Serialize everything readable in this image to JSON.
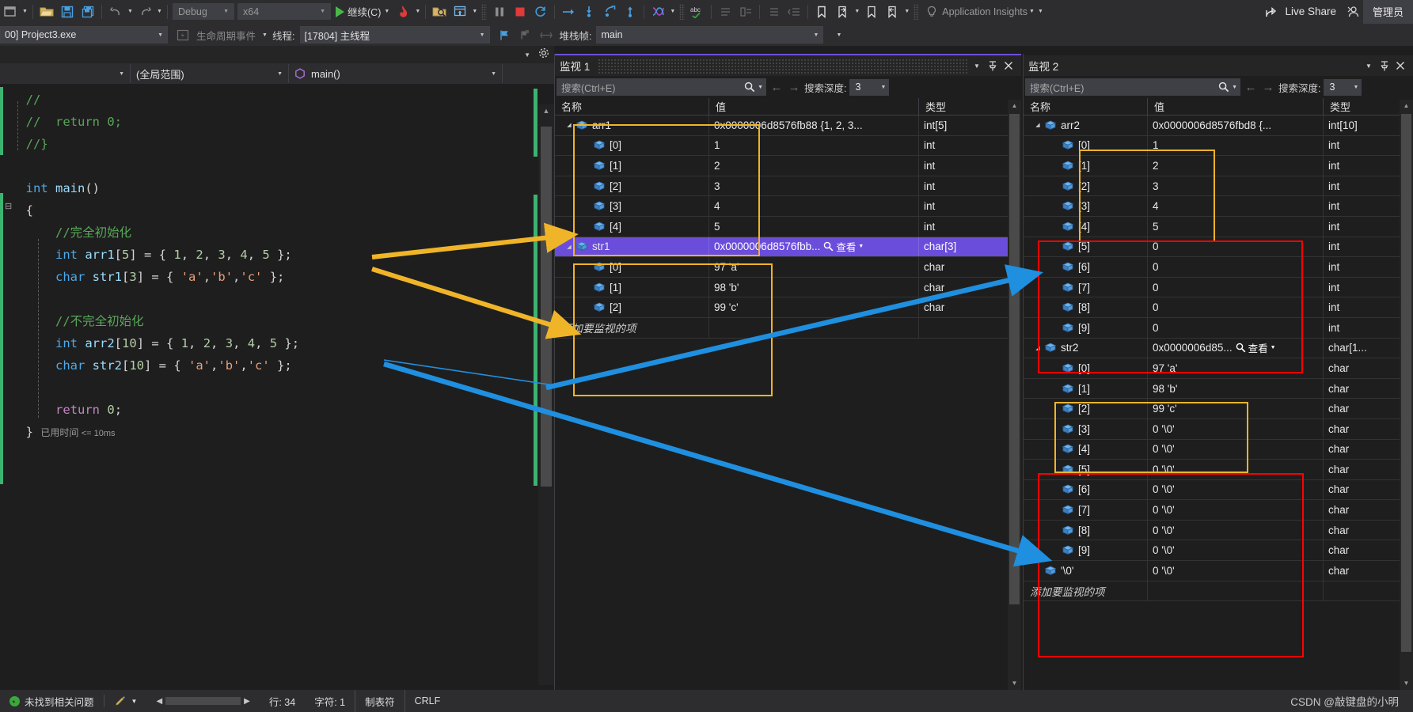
{
  "toolbar": {
    "config_combo": "Debug",
    "platform_combo": "x64",
    "continue_label": "继续(C)",
    "app_insights": "Application Insights",
    "live_share": "Live Share",
    "admin": "管理员",
    "icons": [
      "window-icon",
      "open-folder-icon",
      "save-icon",
      "save-all-icon",
      "undo-icon",
      "redo-icon",
      "play-icon",
      "hot-reload-icon",
      "attach-process-icon",
      "window-layout-icon",
      "pause-icon",
      "stop-icon",
      "restart-icon",
      "step-over-icon",
      "step-into-icon",
      "step-out-icon",
      "step-up-icon",
      "threads-icon",
      "spellcheck-icon",
      "indent-icon",
      "comment-icon",
      "uncomment-icon",
      "outdent-icon",
      "bookmark-icon",
      "bookmark-next-icon",
      "bookmark-prev-icon",
      "lightbulb-icon",
      "share-icon",
      "user-icon"
    ]
  },
  "debugbar": {
    "process_combo": "00] Project3.exe",
    "lifecycle_events": "生命周期事件",
    "thread_label": "线程:",
    "thread_value": "[17804] 主线程",
    "stackframe_label": "堆栈帧:",
    "stackframe_value": "main"
  },
  "editor": {
    "scope_combo": "(全局范围)",
    "member_combo": "main()",
    "empty_combo": "",
    "elapsed_note": "已用时间 <= 10ms",
    "lines": [
      {
        "indent": 0,
        "tokens": [
          {
            "t": "//",
            "c": "c-comment"
          }
        ]
      },
      {
        "indent": 0,
        "tokens": [
          {
            "t": "//  return 0;",
            "c": "c-comment"
          }
        ]
      },
      {
        "indent": 0,
        "tokens": [
          {
            "t": "//}",
            "c": "c-comment"
          }
        ]
      },
      {
        "indent": 0,
        "tokens": []
      },
      {
        "indent": 0,
        "tokens": [
          {
            "t": "int",
            "c": "c-type"
          },
          {
            "t": " ",
            "c": "c-plain"
          },
          {
            "t": "main",
            "c": "c-id"
          },
          {
            "t": "()",
            "c": "c-plain"
          }
        ]
      },
      {
        "indent": 0,
        "tokens": [
          {
            "t": "{",
            "c": "c-plain"
          }
        ]
      },
      {
        "indent": 1,
        "tokens": [
          {
            "t": "//完全初始化",
            "c": "c-comment"
          }
        ]
      },
      {
        "indent": 1,
        "tokens": [
          {
            "t": "int",
            "c": "c-type"
          },
          {
            "t": " ",
            "c": "c-plain"
          },
          {
            "t": "arr1",
            "c": "c-id"
          },
          {
            "t": "[",
            "c": "c-plain"
          },
          {
            "t": "5",
            "c": "c-num"
          },
          {
            "t": "] = { ",
            "c": "c-plain"
          },
          {
            "t": "1",
            "c": "c-num"
          },
          {
            "t": ", ",
            "c": "c-plain"
          },
          {
            "t": "2",
            "c": "c-num"
          },
          {
            "t": ", ",
            "c": "c-plain"
          },
          {
            "t": "3",
            "c": "c-num"
          },
          {
            "t": ", ",
            "c": "c-plain"
          },
          {
            "t": "4",
            "c": "c-num"
          },
          {
            "t": ", ",
            "c": "c-plain"
          },
          {
            "t": "5",
            "c": "c-num"
          },
          {
            "t": " };",
            "c": "c-plain"
          }
        ]
      },
      {
        "indent": 1,
        "tokens": [
          {
            "t": "char",
            "c": "c-type"
          },
          {
            "t": " ",
            "c": "c-plain"
          },
          {
            "t": "str1",
            "c": "c-id"
          },
          {
            "t": "[",
            "c": "c-plain"
          },
          {
            "t": "3",
            "c": "c-num"
          },
          {
            "t": "] = { ",
            "c": "c-plain"
          },
          {
            "t": "'a'",
            "c": "c-str"
          },
          {
            "t": ",",
            "c": "c-plain"
          },
          {
            "t": "'b'",
            "c": "c-str"
          },
          {
            "t": ",",
            "c": "c-plain"
          },
          {
            "t": "'c'",
            "c": "c-str"
          },
          {
            "t": " };",
            "c": "c-plain"
          }
        ]
      },
      {
        "indent": 1,
        "tokens": []
      },
      {
        "indent": 1,
        "tokens": [
          {
            "t": "//不完全初始化",
            "c": "c-comment"
          }
        ]
      },
      {
        "indent": 1,
        "tokens": [
          {
            "t": "int",
            "c": "c-type"
          },
          {
            "t": " ",
            "c": "c-plain"
          },
          {
            "t": "arr2",
            "c": "c-id"
          },
          {
            "t": "[",
            "c": "c-plain"
          },
          {
            "t": "10",
            "c": "c-num"
          },
          {
            "t": "] = { ",
            "c": "c-plain"
          },
          {
            "t": "1",
            "c": "c-num"
          },
          {
            "t": ", ",
            "c": "c-plain"
          },
          {
            "t": "2",
            "c": "c-num"
          },
          {
            "t": ", ",
            "c": "c-plain"
          },
          {
            "t": "3",
            "c": "c-num"
          },
          {
            "t": ", ",
            "c": "c-plain"
          },
          {
            "t": "4",
            "c": "c-num"
          },
          {
            "t": ", ",
            "c": "c-plain"
          },
          {
            "t": "5",
            "c": "c-num"
          },
          {
            "t": " };",
            "c": "c-plain"
          }
        ]
      },
      {
        "indent": 1,
        "tokens": [
          {
            "t": "char",
            "c": "c-type"
          },
          {
            "t": " ",
            "c": "c-plain"
          },
          {
            "t": "str2",
            "c": "c-id"
          },
          {
            "t": "[",
            "c": "c-plain"
          },
          {
            "t": "10",
            "c": "c-num"
          },
          {
            "t": "] = { ",
            "c": "c-plain"
          },
          {
            "t": "'a'",
            "c": "c-str"
          },
          {
            "t": ",",
            "c": "c-plain"
          },
          {
            "t": "'b'",
            "c": "c-str"
          },
          {
            "t": ",",
            "c": "c-plain"
          },
          {
            "t": "'c'",
            "c": "c-str"
          },
          {
            "t": " };",
            "c": "c-plain"
          }
        ]
      },
      {
        "indent": 1,
        "tokens": []
      },
      {
        "indent": 1,
        "tokens": [
          {
            "t": "return",
            "c": "c-ret"
          },
          {
            "t": " ",
            "c": "c-plain"
          },
          {
            "t": "0",
            "c": "c-num"
          },
          {
            "t": ";",
            "c": "c-plain"
          }
        ]
      },
      {
        "indent": 0,
        "tokens": [
          {
            "t": "}",
            "c": "c-plain"
          }
        ]
      }
    ]
  },
  "watch1": {
    "title": "监视 1",
    "search_placeholder": "搜索(Ctrl+E)",
    "depth_label": "搜索深度:",
    "depth_value": "3",
    "columns": [
      "名称",
      "值",
      "类型"
    ],
    "add_watch": "添加要监视的项",
    "view_label": "查看",
    "rows": [
      {
        "name": "arr1",
        "value": "0x0000006d8576fb88 {1, 2, 3...",
        "type": "int[5]",
        "depth": 0,
        "expander": "▾",
        "selected": false
      },
      {
        "name": "[0]",
        "value": "1",
        "type": "int",
        "depth": 1,
        "expander": "",
        "selected": false
      },
      {
        "name": "[1]",
        "value": "2",
        "type": "int",
        "depth": 1,
        "expander": "",
        "selected": false
      },
      {
        "name": "[2]",
        "value": "3",
        "type": "int",
        "depth": 1,
        "expander": "",
        "selected": false
      },
      {
        "name": "[3]",
        "value": "4",
        "type": "int",
        "depth": 1,
        "expander": "",
        "selected": false
      },
      {
        "name": "[4]",
        "value": "5",
        "type": "int",
        "depth": 1,
        "expander": "",
        "selected": false
      },
      {
        "name": "str1",
        "value": "0x0000006d8576fbb...",
        "type": "char[3]",
        "depth": 0,
        "expander": "▾",
        "selected": true,
        "magnifier": true
      },
      {
        "name": "[0]",
        "value": "97 'a'",
        "type": "char",
        "depth": 1,
        "expander": "",
        "selected": false
      },
      {
        "name": "[1]",
        "value": "98 'b'",
        "type": "char",
        "depth": 1,
        "expander": "",
        "selected": false
      },
      {
        "name": "[2]",
        "value": "99 'c'",
        "type": "char",
        "depth": 1,
        "expander": "",
        "selected": false
      }
    ]
  },
  "watch2": {
    "title": "监视 2",
    "search_placeholder": "搜索(Ctrl+E)",
    "depth_label": "搜索深度:",
    "depth_value": "3",
    "columns": [
      "名称",
      "值",
      "类型"
    ],
    "add_watch": "添加要监视的项",
    "view_label": "查看",
    "rows": [
      {
        "name": "arr2",
        "value": "0x0000006d8576fbd8 {...",
        "type": "int[10]",
        "depth": 0,
        "expander": "▾",
        "selected": false
      },
      {
        "name": "[0]",
        "value": "1",
        "type": "int",
        "depth": 1,
        "expander": "",
        "selected": false
      },
      {
        "name": "[1]",
        "value": "2",
        "type": "int",
        "depth": 1,
        "expander": "",
        "selected": false
      },
      {
        "name": "[2]",
        "value": "3",
        "type": "int",
        "depth": 1,
        "expander": "",
        "selected": false
      },
      {
        "name": "[3]",
        "value": "4",
        "type": "int",
        "depth": 1,
        "expander": "",
        "selected": false
      },
      {
        "name": "[4]",
        "value": "5",
        "type": "int",
        "depth": 1,
        "expander": "",
        "selected": false
      },
      {
        "name": "[5]",
        "value": "0",
        "type": "int",
        "depth": 1,
        "expander": "",
        "selected": false
      },
      {
        "name": "[6]",
        "value": "0",
        "type": "int",
        "depth": 1,
        "expander": "",
        "selected": false
      },
      {
        "name": "[7]",
        "value": "0",
        "type": "int",
        "depth": 1,
        "expander": "",
        "selected": false
      },
      {
        "name": "[8]",
        "value": "0",
        "type": "int",
        "depth": 1,
        "expander": "",
        "selected": false
      },
      {
        "name": "[9]",
        "value": "0",
        "type": "int",
        "depth": 1,
        "expander": "",
        "selected": false
      },
      {
        "name": "str2",
        "value": "0x0000006d85...",
        "type": "char[1...",
        "depth": 0,
        "expander": "▾",
        "selected": false,
        "magnifier": true
      },
      {
        "name": "[0]",
        "value": "97 'a'",
        "type": "char",
        "depth": 1,
        "expander": "",
        "selected": false
      },
      {
        "name": "[1]",
        "value": "98 'b'",
        "type": "char",
        "depth": 1,
        "expander": "",
        "selected": false
      },
      {
        "name": "[2]",
        "value": "99 'c'",
        "type": "char",
        "depth": 1,
        "expander": "",
        "selected": false
      },
      {
        "name": "[3]",
        "value": "0 '\\0'",
        "type": "char",
        "depth": 1,
        "expander": "",
        "selected": false
      },
      {
        "name": "[4]",
        "value": "0 '\\0'",
        "type": "char",
        "depth": 1,
        "expander": "",
        "selected": false
      },
      {
        "name": "[5]",
        "value": "0 '\\0'",
        "type": "char",
        "depth": 1,
        "expander": "",
        "selected": false
      },
      {
        "name": "[6]",
        "value": "0 '\\0'",
        "type": "char",
        "depth": 1,
        "expander": "",
        "selected": false
      },
      {
        "name": "[7]",
        "value": "0 '\\0'",
        "type": "char",
        "depth": 1,
        "expander": "",
        "selected": false
      },
      {
        "name": "[8]",
        "value": "0 '\\0'",
        "type": "char",
        "depth": 1,
        "expander": "",
        "selected": false
      },
      {
        "name": "[9]",
        "value": "0 '\\0'",
        "type": "char",
        "depth": 1,
        "expander": "",
        "selected": false
      },
      {
        "name": "'\\0'",
        "value": "0 '\\0'",
        "type": "char",
        "depth": 0,
        "expander": "",
        "selected": false
      }
    ]
  },
  "statusbar": {
    "problem_text": "未找到相关问题",
    "line_label": "行: 34",
    "char_label": "字符: 1",
    "tab_label": "制表符",
    "eol_label": "CRLF",
    "watermark": "CSDN @敲键盘的小明"
  },
  "annotation_colors": {
    "yellow": "#f0b429",
    "red": "#ff0000",
    "blue": "#1f8fe0"
  }
}
